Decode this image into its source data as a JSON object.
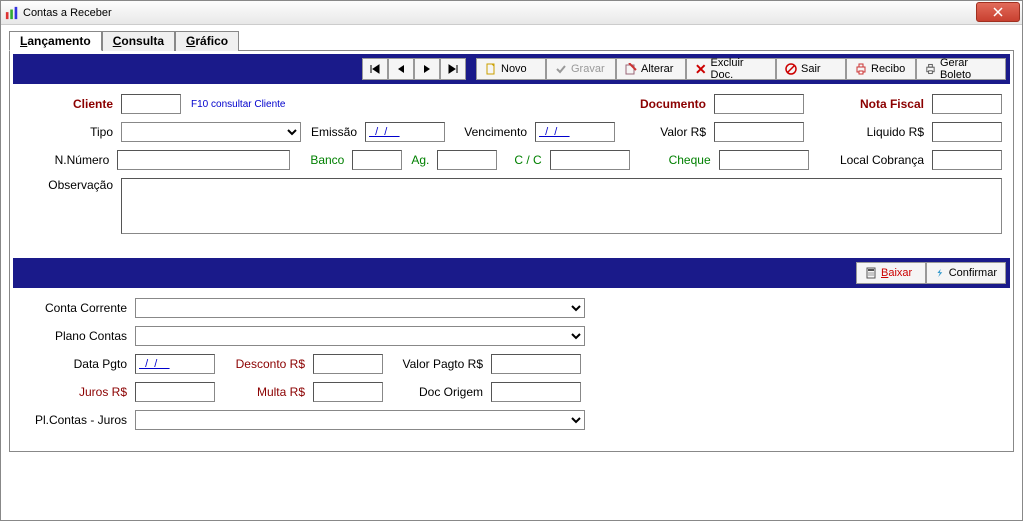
{
  "window": {
    "title": "Contas a Receber"
  },
  "tabs": {
    "lancamento": "Lançamento",
    "consulta": "Consulta",
    "grafico": "Gráfico"
  },
  "toolbar": {
    "novo": "Novo",
    "gravar": "Gravar",
    "alterar": "Alterar",
    "excluir": "Excluir Doc.",
    "sair": "Sair",
    "recibo": "Recibo",
    "gerar_boleto": "Gerar Boleto"
  },
  "labels": {
    "cliente": "Cliente",
    "f10_hint": "F10 consultar Cliente",
    "tipo": "Tipo",
    "emissao": "Emissão",
    "vencimento": "Vencimento",
    "documento": "Documento",
    "nota_fiscal": "Nota Fiscal",
    "valor_rs": "Valor R$",
    "liquido_rs": "Liquido R$",
    "n_numero": "N.Número",
    "banco": "Banco",
    "ag": "Ag.",
    "cc": "C / C",
    "cheque": "Cheque",
    "local_cobranca": "Local Cobrança",
    "observacao": "Observação"
  },
  "midbar": {
    "baixar": "Baixar",
    "confirmar": "Confirmar"
  },
  "labels2": {
    "conta_corrente": "Conta Corrente",
    "plano_contas": "Plano Contas",
    "data_pgto": "Data Pgto",
    "desconto_rs": "Desconto R$",
    "valor_pagto_rs": "Valor Pagto R$",
    "juros_rs": "Juros R$",
    "multa_rs": "Multa R$",
    "doc_origem": "Doc Origem",
    "pl_contas_juros": "Pl.Contas - Juros"
  },
  "values": {
    "cliente": "",
    "tipo": "",
    "emissao": "  /  /    ",
    "vencimento": "  /  /    ",
    "documento": "",
    "nota_fiscal": "",
    "valor_rs": "",
    "liquido_rs": "",
    "n_numero": "",
    "banco": "",
    "ag": "",
    "cc": "",
    "cheque": "",
    "local_cobranca": "",
    "observacao": "",
    "conta_corrente": "",
    "plano_contas": "",
    "data_pgto": "  /  /    ",
    "desconto_rs": "",
    "valor_pagto_rs": "",
    "juros_rs": "",
    "multa_rs": "",
    "doc_origem": "",
    "pl_contas_juros": ""
  }
}
